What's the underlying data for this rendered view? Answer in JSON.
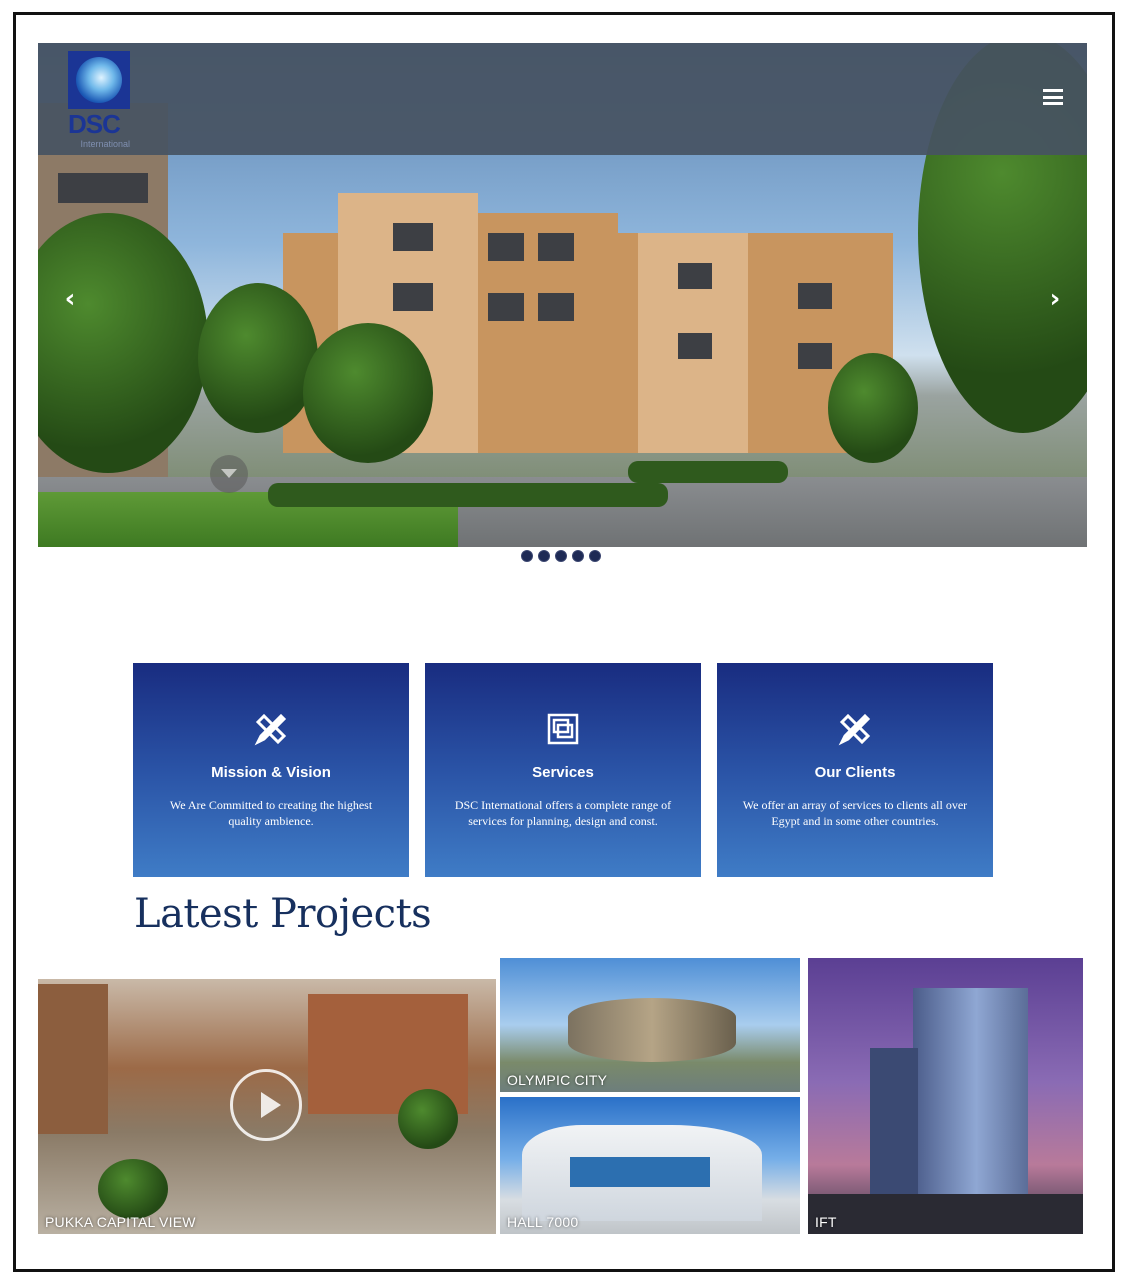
{
  "header": {
    "logo_text": "DSC",
    "logo_sub": "International"
  },
  "icons": {
    "menu": "hamburger-menu-icon",
    "prev": "chevron-left-icon",
    "next": "chevron-right-icon",
    "scroll": "chevron-down-icon",
    "mission": "pencil-ruler-icon",
    "services": "layers-icon",
    "clients": "pencil-ruler-icon",
    "play": "play-icon"
  },
  "slider": {
    "prev_glyph": "‹",
    "next_glyph": "›",
    "slide_count": 5,
    "active_index": 2
  },
  "cards": [
    {
      "title": "Mission & Vision",
      "text": "We Are Committed to creating the highest quality ambience."
    },
    {
      "title": "Services",
      "text": "DSC International offers a complete range of services for planning, design and const."
    },
    {
      "title": "Our Clients",
      "text": "We offer an array of services to clients all over Egypt and in some other countries."
    }
  ],
  "latest_projects": {
    "title": "Latest Projects",
    "items": [
      {
        "label": "PUKKA CAPITAL VIEW"
      },
      {
        "label": "OLYMPIC CITY"
      },
      {
        "label": "HALL 7000"
      },
      {
        "label": "IFT"
      }
    ]
  },
  "colors": {
    "card_top": "#192c80",
    "card_bottom": "#3f7cc6",
    "title": "#17305e"
  }
}
